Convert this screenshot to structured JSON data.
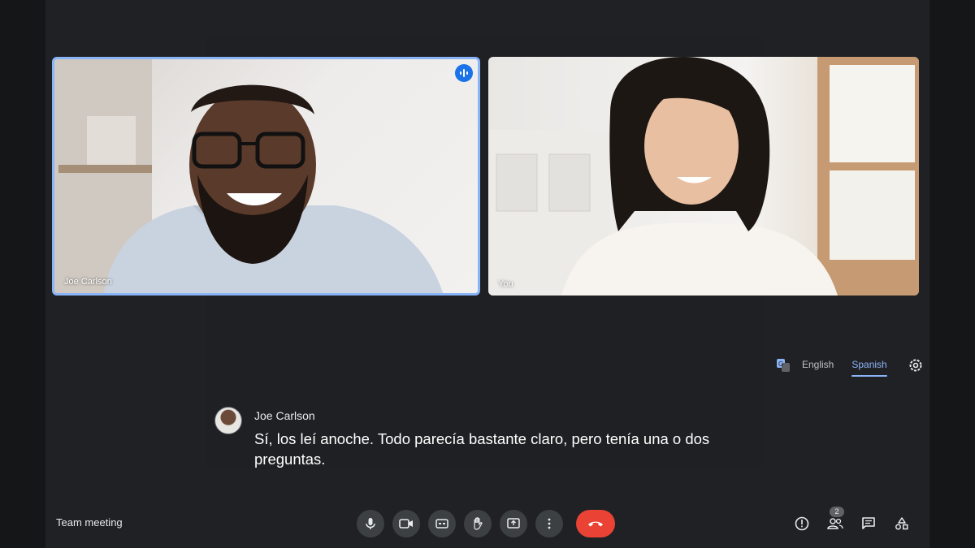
{
  "tiles": [
    {
      "name": "Joe Carlson",
      "speaking": true
    },
    {
      "name": "You",
      "speaking": false
    }
  ],
  "captions": {
    "languages": [
      "English",
      "Spanish"
    ],
    "selected_language": "Spanish",
    "speaker": "Joe Carlson",
    "text": "Sí, los leí anoche. Todo parecía bastante claro, pero tenía una o dos preguntas."
  },
  "meeting": {
    "title": "Team meeting"
  },
  "controls": [
    "microphone-icon",
    "camera-icon",
    "captions-icon",
    "raise-hand-icon",
    "present-icon",
    "more-options-icon",
    "end-call-icon"
  ],
  "right_panel": {
    "people_count": "2"
  },
  "colors": {
    "accent": "#8ab4f8",
    "end_call": "#ea4335",
    "background": "#202124",
    "control": "#3c4043"
  }
}
